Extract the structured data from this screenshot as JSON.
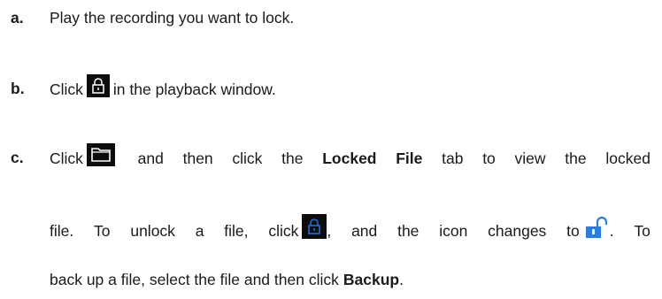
{
  "steps": [
    {
      "marker": "a.",
      "text": "Play the recording you want to lock."
    },
    {
      "marker": "b.",
      "before": "Click",
      "icon": "lock-icon",
      "after": "in the playback window."
    },
    {
      "marker": "c.",
      "line1_before": "Click",
      "line1_icon": "folder-icon",
      "line1_words_a": [
        "and",
        "then",
        "click",
        "the"
      ],
      "line1_bold": [
        "Locked",
        "File"
      ],
      "line1_words_b": [
        "tab",
        "to",
        "view",
        "the",
        "locked"
      ],
      "line2_words_a": [
        "file.",
        "To",
        "unlock",
        "a",
        "file,",
        "click"
      ],
      "line2_icon_a": "locked-lock-icon",
      "line2_words_b": [
        ",",
        "and",
        "the",
        "icon",
        "changes",
        "to"
      ],
      "line2_icon_b": "unlocked-lock-icon",
      "line2_words_c": [
        ".",
        "To"
      ],
      "line3_text": "back up a file, select the file and then click",
      "line3_bold": "Backup",
      "line3_end": "."
    }
  ],
  "colors": {
    "text": "#1a1a1a",
    "icon_bg": "#0c0c0c",
    "icon_blue": "#1e6fd9",
    "unlock_blue": "#2a7de1"
  }
}
